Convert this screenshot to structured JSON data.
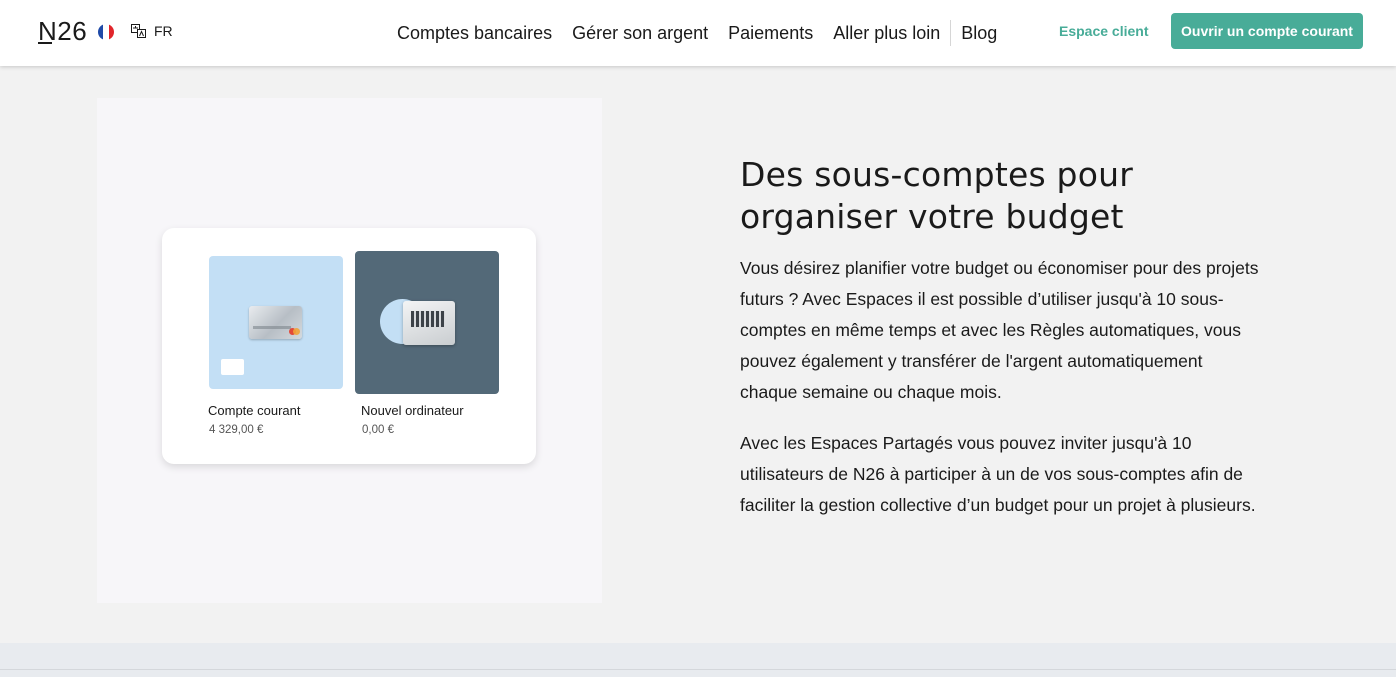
{
  "header": {
    "logo": "N26",
    "language": "FR",
    "flag_colors": [
      "#1f4aa8",
      "#ffffff",
      "#e1252b"
    ],
    "nav": [
      {
        "label": "Comptes bancaires"
      },
      {
        "label": "Gérer son argent"
      },
      {
        "label": "Paiements"
      },
      {
        "label": "Aller plus loin"
      },
      {
        "label": "Blog"
      }
    ],
    "espace_client": "Espace client",
    "cta": "Ouvrir un compte courant",
    "accent_color": "#48ac98"
  },
  "illustration": {
    "accounts": [
      {
        "name": "Compte courant",
        "amount": "4 329,00 €"
      },
      {
        "name": "Nouvel ordinateur",
        "amount": "0,00 €"
      }
    ]
  },
  "content": {
    "heading": "Des sous-comptes pour organiser votre budget",
    "paragraph1": "Vous désirez planifier votre budget ou économiser pour des projets futurs ? Avec Espaces il est possible d’utiliser jusqu'à 10 sous-comptes en même temps et avec les Règles automatiques, vous pouvez également y transférer de l'argent automatiquement chaque semaine ou chaque mois.",
    "paragraph2": "Avec les Espaces Partagés vous pouvez inviter jusqu'à 10 utilisateurs de N26 à participer à un de vos sous-comptes afin de faciliter la gestion collective d’un budget pour un projet à plusieurs."
  }
}
